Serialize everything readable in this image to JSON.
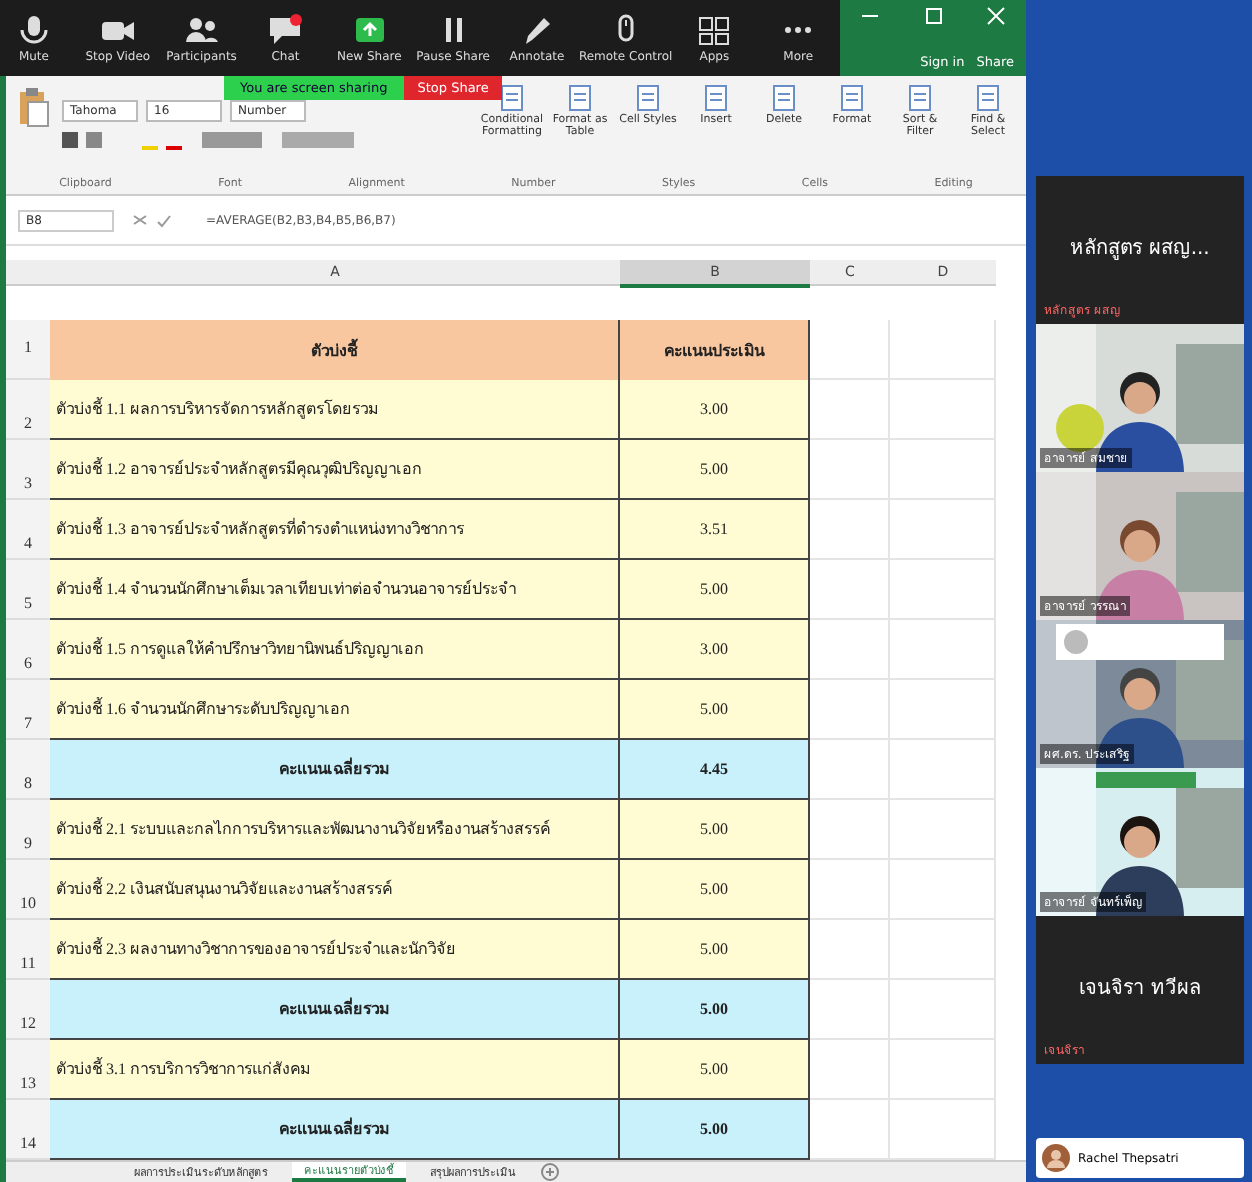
{
  "zoom_toolbar": {
    "items": [
      {
        "label": "Mute"
      },
      {
        "label": "Stop Video"
      },
      {
        "label": "Participants"
      },
      {
        "label": "Chat"
      },
      {
        "label": "New Share"
      },
      {
        "label": "Pause Share"
      },
      {
        "label": "Annotate"
      },
      {
        "label": "Remote Control"
      },
      {
        "label": "Apps"
      },
      {
        "label": "More"
      }
    ],
    "share_banner": "You are screen sharing",
    "stop_share": "Stop Share"
  },
  "excel": {
    "account": {
      "sign_in": "Sign in",
      "share": "Share"
    },
    "ribbon": {
      "font_name": "Tahoma",
      "font_size": "16",
      "number_format": "Number",
      "buttons": [
        {
          "label": "Conditional Formatting"
        },
        {
          "label": "Format as Table"
        },
        {
          "label": "Cell Styles"
        },
        {
          "label": "Insert"
        },
        {
          "label": "Delete"
        },
        {
          "label": "Format"
        },
        {
          "label": "Sort & Filter"
        },
        {
          "label": "Find & Select"
        }
      ],
      "groups": [
        "Clipboard",
        "Font",
        "Alignment",
        "Number",
        "Styles",
        "Cells",
        "Editing"
      ]
    },
    "formula_bar": {
      "name_box": "B8",
      "formula": "=AVERAGE(B2,B3,B4,B5,B6,B7)"
    },
    "sheet": {
      "columns": [
        "A",
        "B",
        "C",
        "D"
      ],
      "rows": [
        {
          "number": "1",
          "kind": "header",
          "cells": [
            "ตัวบ่งชี้",
            "คะแนนประเมิน"
          ]
        },
        {
          "number": "2",
          "kind": "item",
          "cells": [
            "ตัวบ่งชี้ 1.1  ผลการบริหารจัดการหลักสูตรโดยรวม",
            "3.00"
          ]
        },
        {
          "number": "3",
          "kind": "item",
          "cells": [
            "ตัวบ่งชี้ 1.2  อาจารย์ประจำหลักสูตรมีคุณวุฒิปริญญาเอก",
            "5.00"
          ]
        },
        {
          "number": "4",
          "kind": "item",
          "cells": [
            "ตัวบ่งชี้ 1.3  อาจารย์ประจำหลักสูตรที่ดำรงตำแหน่งทางวิชาการ",
            "3.51"
          ]
        },
        {
          "number": "5",
          "kind": "item",
          "cells": [
            "ตัวบ่งชี้ 1.4  จำนวนนักศึกษาเต็มเวลาเทียบเท่าต่อจำนวนอาจารย์ประจำ",
            "5.00"
          ]
        },
        {
          "number": "6",
          "kind": "item",
          "cells": [
            "ตัวบ่งชี้ 1.5  การดูแลให้คำปรึกษาวิทยานิพนธ์ปริญญาเอก",
            "3.00"
          ]
        },
        {
          "number": "7",
          "kind": "item",
          "cells": [
            "ตัวบ่งชี้ 1.6  จำนวนนักศึกษาระดับปริญญาเอก",
            "5.00"
          ]
        },
        {
          "number": "8",
          "kind": "total",
          "cells": [
            "คะแนนเฉลี่ยรวม",
            "4.45"
          ]
        },
        {
          "number": "9",
          "kind": "item",
          "cells": [
            "ตัวบ่งชี้ 2.1  ระบบและกลไกการบริหารและพัฒนางานวิจัยหรืองานสร้างสรรค์",
            "5.00"
          ]
        },
        {
          "number": "10",
          "kind": "item",
          "cells": [
            "ตัวบ่งชี้ 2.2  เงินสนับสนุนงานวิจัยและงานสร้างสรรค์",
            "5.00"
          ]
        },
        {
          "number": "11",
          "kind": "item",
          "cells": [
            "ตัวบ่งชี้ 2.3  ผลงานทางวิชาการของอาจารย์ประจำและนักวิจัย",
            "5.00"
          ]
        },
        {
          "number": "12",
          "kind": "total",
          "cells": [
            "คะแนนเฉลี่ยรวม",
            "5.00"
          ]
        },
        {
          "number": "13",
          "kind": "item",
          "cells": [
            "ตัวบ่งชี้ 3.1  การบริการวิชาการแก่สังคม",
            "5.00"
          ]
        },
        {
          "number": "14",
          "kind": "total",
          "cells": [
            "คะแนนเฉลี่ยรวม",
            "5.00"
          ]
        }
      ]
    },
    "sheet_tabs": [
      {
        "label": "ผลการประเมินระดับหลักสูตร",
        "selected": false
      },
      {
        "label": "คะแนนรายตัวบ่งชี้",
        "selected": true
      },
      {
        "label": "สรุปผลการประเมิน",
        "selected": false
      }
    ]
  },
  "participants": [
    {
      "kind": "name_tile",
      "name": "หลักสูตร ผสญ...",
      "label": "หลักสูตร ผสญ"
    },
    {
      "kind": "video",
      "label": "อาจารย์ สมชาย"
    },
    {
      "kind": "video",
      "label": "อาจารย์ วรรณา"
    },
    {
      "kind": "video",
      "label": "ผศ.ดร. ประเสริฐ"
    },
    {
      "kind": "video",
      "label": "อาจารย์ จันทร์เพ็ญ"
    },
    {
      "kind": "name_tile",
      "name": "เจนจิรา ทวีผล",
      "label": "เจนจิรา"
    }
  ],
  "chat_notification": {
    "sender": "Rachel Thepsatri"
  }
}
